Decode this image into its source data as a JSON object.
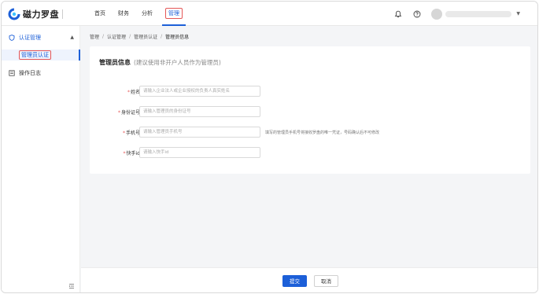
{
  "brand": {
    "name": "磁力罗盘",
    "accent": "#1c5fd8",
    "mark_color": "#1c5fd8"
  },
  "topnav": {
    "items": [
      {
        "label": "首页",
        "active": false
      },
      {
        "label": "财务",
        "active": false
      },
      {
        "label": "分析",
        "active": false
      },
      {
        "label": "管理",
        "active": true
      }
    ]
  },
  "header_icons": [
    "bell-icon",
    "help-icon",
    "avatar",
    "chevron-down-icon"
  ],
  "sidebar": {
    "group_label": "认证管理",
    "sub_label": "管理员认证",
    "log_label": "操作日志"
  },
  "breadcrumb": {
    "items": [
      "管理",
      "认证管理",
      "管理员认证",
      "管理员信息"
    ],
    "sep": "/"
  },
  "form": {
    "title": "管理员信息",
    "subtitle": "(建议使用非开户人员作为管理员)",
    "required_mark": "*",
    "fields": [
      {
        "label": "姓名:",
        "placeholder": "请输入企业法人或企业授权的负责人真实姓名",
        "value": ""
      },
      {
        "label": "身份证号:",
        "placeholder": "请输入管理员的身份证号",
        "value": ""
      },
      {
        "label": "手机号:",
        "placeholder": "请输入管理员手机号",
        "value": "",
        "hint": "填写的管理员手机号将接收罗盘的唯一凭证，号码确认后不可修改"
      },
      {
        "label": "快手id:",
        "placeholder": "请输入快手id",
        "value": ""
      }
    ]
  },
  "footer": {
    "submit_label": "提交",
    "cancel_label": "取消"
  }
}
